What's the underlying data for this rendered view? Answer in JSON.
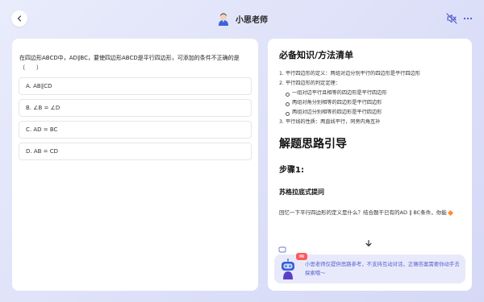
{
  "header": {
    "title": "小思老师"
  },
  "question": {
    "stem": "在四边形ABCD中，AD∥BC，要使四边形ABCD是平行四边形，可添加的条件不正确的是（　　）",
    "options": [
      "A. AB∥CD",
      "B. ∠B = ∠D",
      "C. AD = BC",
      "D. AB = CD"
    ]
  },
  "knowledge": {
    "title": "必备知识/方法清单",
    "items": [
      "1. 平行四边形的定义：两组对边分别平行的四边形是平行四边形",
      "2. 平行四边形的判定定理：",
      "3. 平行线的性质：两直线平行，同旁内角互补"
    ],
    "subitems": [
      "一组对边平行且相等的四边形是平行四边形",
      "两组对角分别相等的四边形是平行四边形",
      "两组对边分别相等的四边形是平行四边形"
    ]
  },
  "guide": {
    "title": "解题思路引导",
    "step": "步骤1:",
    "method": "苏格拉底式提问",
    "prompt": "回忆一下平行四边形的定义是什么？结合题干已有的AD ∥ BC条件，你能"
  },
  "notice": {
    "badge": "Hi",
    "text": "小思老师仅提供思路参考，不支持互动对话，正确答案需要你动手去探索哦～"
  }
}
